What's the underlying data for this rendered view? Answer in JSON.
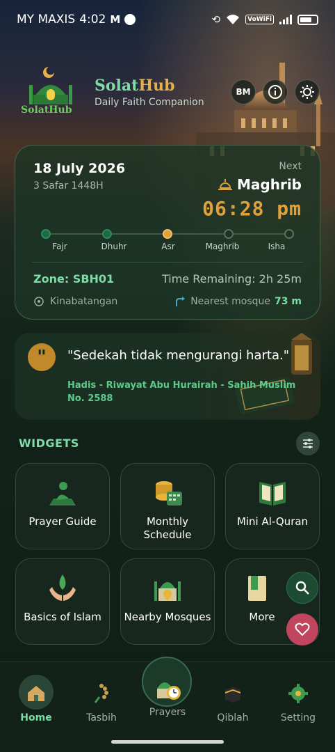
{
  "status_bar": {
    "carrier": "MY MAXIS",
    "time": "4:02",
    "wifi_badge": "VoWiFi"
  },
  "header": {
    "logo_text": "SolatHub",
    "brand_prefix": "Solat",
    "brand_suffix": "Hub",
    "tagline": "Daily Faith Companion",
    "language_button": "BM"
  },
  "prayer_card": {
    "date": "18 July 2026",
    "hijri_date": "3 Safar 1448H",
    "next_label": "Next",
    "next_prayer": "Maghrib",
    "next_time": "06:28 pm",
    "timeline": [
      {
        "name": "Fajr",
        "state": "done"
      },
      {
        "name": "Dhuhr",
        "state": "done"
      },
      {
        "name": "Asr",
        "state": "current"
      },
      {
        "name": "Maghrib",
        "state": "pending"
      },
      {
        "name": "Isha",
        "state": "pending"
      }
    ],
    "zone": "Zone: SBH01",
    "time_remaining": "Time Remaining: 2h 25m",
    "location": "Kinabatangan",
    "nearest_mosque_label": "Nearest mosque",
    "nearest_mosque_distance": "73 m"
  },
  "quote": {
    "text": "\"Sedekah tidak mengurangi harta.\"",
    "source": "Hadis - Riwayat Abu Hurairah - Sahih Muslim No. 2588"
  },
  "widgets": {
    "title": "WIDGETS",
    "items": [
      {
        "label": "Prayer Guide",
        "icon": "prayer-mat-icon"
      },
      {
        "label": "Monthly Schedule",
        "icon": "calendar-coins-icon"
      },
      {
        "label": "Mini Al-Quran",
        "icon": "quran-book-icon"
      },
      {
        "label": "Basics of Islam",
        "icon": "hands-drop-icon"
      },
      {
        "label": "Nearby Mosques",
        "icon": "mosque-pin-icon"
      },
      {
        "label": "More",
        "icon": "bookmark-icon"
      }
    ]
  },
  "bottom_nav": {
    "items": [
      {
        "label": "Home",
        "icon": "home-mosque-icon",
        "active": true
      },
      {
        "label": "Tasbih",
        "icon": "tasbih-icon",
        "active": false
      },
      {
        "label": "Prayers",
        "icon": "prayers-clock-icon",
        "active": false
      },
      {
        "label": "Qiblah",
        "icon": "kaaba-icon",
        "active": false
      },
      {
        "label": "Setting",
        "icon": "gear-icon",
        "active": false
      }
    ]
  },
  "colors": {
    "accent_green": "#7fdca7",
    "accent_gold": "#e0a03a",
    "favorite_pink": "#c0455f"
  }
}
